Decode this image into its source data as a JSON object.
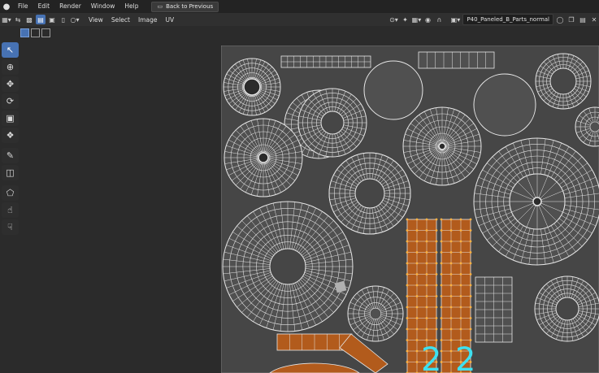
{
  "topbar": {
    "logo_icon": "blender-logo-icon",
    "menus": [
      "File",
      "Edit",
      "Render",
      "Window",
      "Help"
    ],
    "back_button": "Back to Previous"
  },
  "header": {
    "menus": [
      "View",
      "Select",
      "Image",
      "UV"
    ],
    "image_name": "P40_Paneled_B_Parts_normal"
  },
  "overlay_numbers": [
    "2",
    "2"
  ],
  "colors": {
    "accent": "#4772b3",
    "selected_face": "#b25b1c",
    "selected_vertex": "#ffb340",
    "mesh_wire": "#e6e6e6",
    "overlay_number": "#3ee0f0"
  }
}
